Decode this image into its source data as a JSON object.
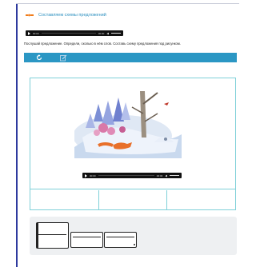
{
  "header": {
    "title": "Составляем схемы предложений",
    "icon": "pointer-hand-icon",
    "accent": "#f07c1a"
  },
  "top_audio": {
    "current_time": "00:00",
    "duration": "00:00",
    "volume_icon": "speaker-icon"
  },
  "instruction": "Послушай предложение. Определи, сколько в нём слов. Составь схему предложения под рисунком.",
  "toolbar": {
    "buttons": [
      {
        "name": "refresh",
        "icon": "refresh-icon"
      },
      {
        "name": "edit",
        "icon": "edit-icon"
      }
    ],
    "color": "#2b97c4"
  },
  "picture": {
    "description_icon": "winter-forest-fox-illustration"
  },
  "picture_audio": {
    "current_time": "00:00",
    "duration": "00:00",
    "volume_icon": "speaker-icon"
  },
  "answer_cells": [
    "",
    "",
    ""
  ],
  "scheme_boxes": [
    {
      "kind": "capital-word"
    },
    {
      "kind": "word"
    },
    {
      "kind": "word-with-period"
    }
  ]
}
